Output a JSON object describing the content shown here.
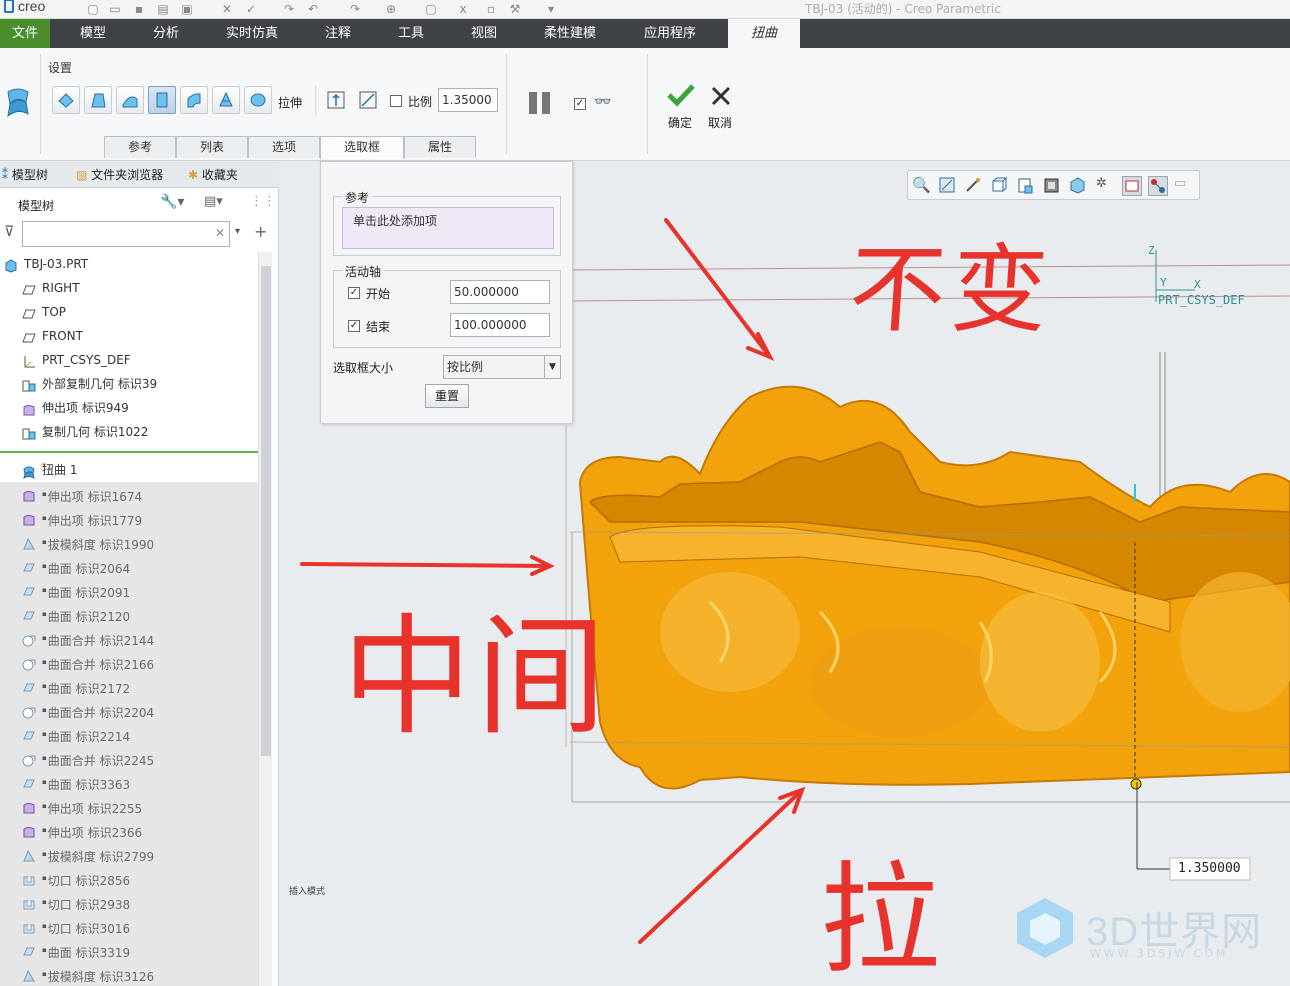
{
  "app": {
    "logo": "creo",
    "window_title": "TBJ-03 (活动的) - Creo Parametric"
  },
  "ribbon_tabs": [
    {
      "label": "文件",
      "kind": "file"
    },
    {
      "label": "模型"
    },
    {
      "label": "分析"
    },
    {
      "label": "实时仿真"
    },
    {
      "label": "注释"
    },
    {
      "label": "工具"
    },
    {
      "label": "视图"
    },
    {
      "label": "柔性建模"
    },
    {
      "label": "应用程序"
    },
    {
      "label": "扭曲",
      "kind": "active"
    }
  ],
  "ribbon": {
    "group_label": "设置",
    "stretch_label": "拉伸",
    "ratio_label": "比例",
    "ratio_value": "1.35000",
    "ok_label": "确定",
    "cancel_label": "取消",
    "subtabs": [
      "参考",
      "列表",
      "选项",
      "选取框",
      "属性"
    ],
    "active_subtab": "选取框"
  },
  "navigator": {
    "tabs": [
      "模型树",
      "文件夹浏览器",
      "收藏夹"
    ],
    "tree_title": "模型树",
    "filter_placeholder": ""
  },
  "tree": [
    {
      "label": "TBJ-03.PRT",
      "icon": "part-icon",
      "indent": 0
    },
    {
      "label": "RIGHT",
      "icon": "datum-plane-icon",
      "indent": 1
    },
    {
      "label": "TOP",
      "icon": "datum-plane-icon",
      "indent": 1
    },
    {
      "label": "FRONT",
      "icon": "datum-plane-icon",
      "indent": 1
    },
    {
      "label": "PRT_CSYS_DEF",
      "icon": "csys-icon",
      "indent": 1
    },
    {
      "label": "外部复制几何 标识39",
      "icon": "copy-geom-icon",
      "indent": 1
    },
    {
      "label": "伸出项 标识949",
      "icon": "protrusion-icon",
      "indent": 1
    },
    {
      "label": "复制几何 标识1022",
      "icon": "copy-geom-icon",
      "indent": 1
    },
    {
      "label": "扭曲 1",
      "icon": "warp-icon",
      "indent": 1,
      "insert": true
    },
    {
      "label": "伸出项 标识1674",
      "icon": "protrusion-icon",
      "indent": 1,
      "suppressed": true
    },
    {
      "label": "伸出项 标识1779",
      "icon": "protrusion-icon",
      "indent": 1,
      "suppressed": true
    },
    {
      "label": "拔模斜度 标识1990",
      "icon": "draft-icon",
      "indent": 1,
      "suppressed": true
    },
    {
      "label": "曲面 标识2064",
      "icon": "surface-icon",
      "indent": 1,
      "suppressed": true
    },
    {
      "label": "曲面 标识2091",
      "icon": "surface-icon",
      "indent": 1,
      "suppressed": true
    },
    {
      "label": "曲面 标识2120",
      "icon": "surface-icon",
      "indent": 1,
      "suppressed": true
    },
    {
      "label": "曲面合并 标识2144",
      "icon": "merge-icon",
      "indent": 1,
      "suppressed": true
    },
    {
      "label": "曲面合并 标识2166",
      "icon": "merge-icon",
      "indent": 1,
      "suppressed": true
    },
    {
      "label": "曲面 标识2172",
      "icon": "surface-icon",
      "indent": 1,
      "suppressed": true
    },
    {
      "label": "曲面合并 标识2204",
      "icon": "merge-icon",
      "indent": 1,
      "suppressed": true
    },
    {
      "label": "曲面 标识2214",
      "icon": "surface-icon",
      "indent": 1,
      "suppressed": true
    },
    {
      "label": "曲面合并 标识2245",
      "icon": "merge-icon",
      "indent": 1,
      "suppressed": true
    },
    {
      "label": "曲面 标识3363",
      "icon": "surface-icon",
      "indent": 1,
      "suppressed": true
    },
    {
      "label": "伸出项 标识2255",
      "icon": "protrusion-icon",
      "indent": 1,
      "suppressed": true
    },
    {
      "label": "伸出项 标识2366",
      "icon": "protrusion-icon",
      "indent": 1,
      "suppressed": true
    },
    {
      "label": "拔模斜度 标识2799",
      "icon": "draft-icon",
      "indent": 1,
      "suppressed": true
    },
    {
      "label": "切口 标识2856",
      "icon": "cut-icon",
      "indent": 1,
      "suppressed": true
    },
    {
      "label": "切口 标识2938",
      "icon": "cut-icon",
      "indent": 1,
      "suppressed": true
    },
    {
      "label": "切口 标识3016",
      "icon": "cut-icon",
      "indent": 1,
      "suppressed": true
    },
    {
      "label": "曲面 标识3319",
      "icon": "surface-icon",
      "indent": 1,
      "suppressed": true
    },
    {
      "label": "拔模斜度 标识3126",
      "icon": "draft-icon",
      "indent": 1,
      "suppressed": true
    }
  ],
  "panel": {
    "ref_group": "参考",
    "ref_placeholder": "单击此处添加项",
    "axis_group": "活动轴",
    "start_label": "开始",
    "start_value": "50.000000",
    "end_label": "结束",
    "end_value": "100.000000",
    "size_label": "选取框大小",
    "size_value": "按比例",
    "reset_label": "重置"
  },
  "viewport": {
    "csys_label": "PRT_CSYS_DEF",
    "axis_x": "X",
    "axis_y": "Y",
    "axis_z": "Z",
    "dimension_value": "1.350000",
    "small_text": "插入模式",
    "annotations": {
      "top": "不变",
      "middle": "中间",
      "bottom": "拉"
    },
    "model_color": "#f0a000"
  },
  "watermark": {
    "text": "3D世界网",
    "url": "WWW.3DSJW.COM"
  },
  "colors": {
    "file_tab": "#4a8f2c",
    "tab_bar": "#3f4347",
    "annotation_red": "#e8332d"
  }
}
